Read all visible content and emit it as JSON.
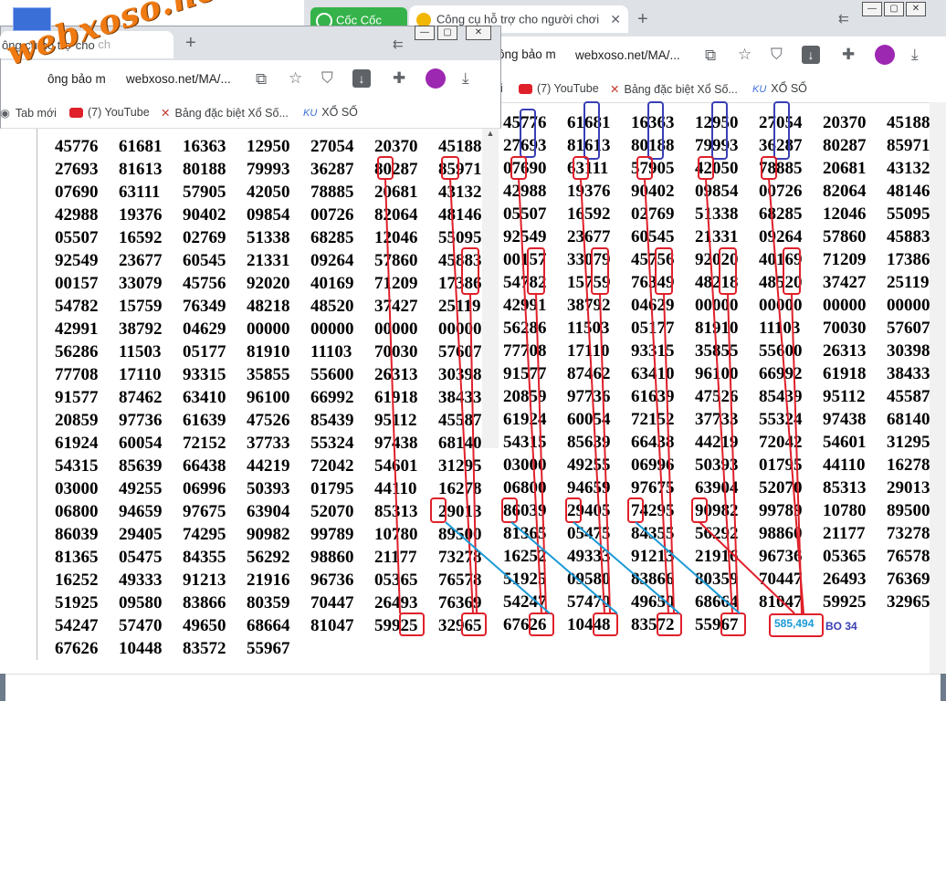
{
  "watermark": "webxoso.net",
  "back_window": {
    "tab_cococ_label": "Cốc Cốc",
    "tab_title": "Công cụ hỗ trợ cho người chơi",
    "tab_close": "✕",
    "new_tab": "+",
    "nav_left_text": "ông bảo m",
    "address": "webxoso.net/MA/...",
    "bookmarks": [
      {
        "icon": "youtube-icon",
        "label": "(7) YouTube"
      },
      {
        "icon": "lottery-site-icon",
        "label": "Bảng đặc biệt Xổ Số..."
      },
      {
        "icon": "xoso-icon",
        "label": "XỔ SỐ"
      }
    ],
    "bookmark_partial": "i"
  },
  "front_window": {
    "tab_title": "ông cụ hỗ trợ cho",
    "tab_title_faded": "ch",
    "new_tab": "+",
    "nav_left_text": "ông bảo m",
    "address": "webxoso.net/MA/...",
    "bookmarks": [
      {
        "icon": "newtab-icon",
        "label": "Tab mới"
      },
      {
        "icon": "youtube-icon",
        "label": "(7) YouTube"
      },
      {
        "icon": "lottery-site-icon",
        "label": "Bảng đặc biệt Xổ Số..."
      },
      {
        "icon": "xoso-icon",
        "label": "XỔ SỐ"
      }
    ]
  },
  "left_grid": [
    [
      "45776",
      "61681",
      "16363",
      "12950",
      "27054",
      "20370",
      "45188"
    ],
    [
      "27693",
      "81613",
      "80188",
      "79993",
      "36287",
      "80287",
      "85971"
    ],
    [
      "07690",
      "63111",
      "57905",
      "42050",
      "78885",
      "20681",
      "43132"
    ],
    [
      "42988",
      "19376",
      "90402",
      "09854",
      "00726",
      "82064",
      "48146"
    ],
    [
      "05507",
      "16592",
      "02769",
      "51338",
      "68285",
      "12046",
      "55095"
    ],
    [
      "92549",
      "23677",
      "60545",
      "21331",
      "09264",
      "57860",
      "45883"
    ],
    [
      "00157",
      "33079",
      "45756",
      "92020",
      "40169",
      "71209",
      "17386"
    ],
    [
      "54782",
      "15759",
      "76349",
      "48218",
      "48520",
      "37427",
      "25119"
    ],
    [
      "42991",
      "38792",
      "04629",
      "00000",
      "00000",
      "00000",
      "00000"
    ],
    [
      "56286",
      "11503",
      "05177",
      "81910",
      "11103",
      "70030",
      "57607"
    ],
    [
      "77708",
      "17110",
      "93315",
      "35855",
      "55600",
      "26313",
      "30398"
    ],
    [
      "91577",
      "87462",
      "63410",
      "96100",
      "66992",
      "61918",
      "38433"
    ],
    [
      "20859",
      "97736",
      "61639",
      "47526",
      "85439",
      "95112",
      "45587"
    ],
    [
      "61924",
      "60054",
      "72152",
      "37733",
      "55324",
      "97438",
      "68140"
    ],
    [
      "54315",
      "85639",
      "66438",
      "44219",
      "72042",
      "54601",
      "31295"
    ],
    [
      "03000",
      "49255",
      "06996",
      "50393",
      "01795",
      "44110",
      "16278"
    ],
    [
      "06800",
      "94659",
      "97675",
      "63904",
      "52070",
      "85313",
      "29013"
    ],
    [
      "86039",
      "29405",
      "74295",
      "90982",
      "99789",
      "10780",
      "89500"
    ],
    [
      "81365",
      "05475",
      "84355",
      "56292",
      "98860",
      "21177",
      "73278"
    ],
    [
      "16252",
      "49333",
      "91213",
      "21916",
      "96736",
      "05365",
      "76578"
    ],
    [
      "51925",
      "09580",
      "83866",
      "80359",
      "70447",
      "26493",
      "76369"
    ],
    [
      "54247",
      "57470",
      "49650",
      "68664",
      "81047",
      "59925",
      "32965"
    ],
    [
      "67626",
      "10448",
      "83572",
      "55967",
      "",
      "",
      ""
    ]
  ],
  "right_grid": [
    [
      "45776",
      "61681",
      "16363",
      "12950",
      "27054",
      "20370",
      "45188"
    ],
    [
      "27693",
      "81613",
      "80188",
      "79993",
      "36287",
      "80287",
      "85971"
    ],
    [
      "07690",
      "63111",
      "57905",
      "42050",
      "78885",
      "20681",
      "43132"
    ],
    [
      "42988",
      "19376",
      "90402",
      "09854",
      "00726",
      "82064",
      "48146"
    ],
    [
      "05507",
      "16592",
      "02769",
      "51338",
      "68285",
      "12046",
      "55095"
    ],
    [
      "92549",
      "23677",
      "60545",
      "21331",
      "09264",
      "57860",
      "45883"
    ],
    [
      "00157",
      "33079",
      "45756",
      "92020",
      "40169",
      "71209",
      "17386"
    ],
    [
      "54782",
      "15759",
      "76349",
      "48218",
      "48520",
      "37427",
      "25119"
    ],
    [
      "42991",
      "38792",
      "04629",
      "00000",
      "00000",
      "00000",
      "00000"
    ],
    [
      "56286",
      "11503",
      "05177",
      "81910",
      "11103",
      "70030",
      "57607"
    ],
    [
      "77708",
      "17110",
      "93315",
      "35855",
      "55600",
      "26313",
      "30398"
    ],
    [
      "91577",
      "87462",
      "63410",
      "96100",
      "66992",
      "61918",
      "38433"
    ],
    [
      "20859",
      "97736",
      "61639",
      "47526",
      "85439",
      "95112",
      "45587"
    ],
    [
      "61924",
      "60054",
      "72152",
      "37733",
      "55324",
      "97438",
      "68140"
    ],
    [
      "54315",
      "85639",
      "66438",
      "44219",
      "72042",
      "54601",
      "31295"
    ],
    [
      "03000",
      "49255",
      "06996",
      "50393",
      "01795",
      "44110",
      "16278"
    ],
    [
      "06800",
      "94659",
      "97675",
      "63904",
      "52070",
      "85313",
      "29013"
    ],
    [
      "86039",
      "29405",
      "74295",
      "90982",
      "99789",
      "10780",
      "89500"
    ],
    [
      "81365",
      "05475",
      "84355",
      "56292",
      "98860",
      "21177",
      "73278"
    ],
    [
      "16252",
      "49333",
      "91213",
      "21916",
      "96736",
      "05365",
      "76578"
    ],
    [
      "51925",
      "09580",
      "83866",
      "80359",
      "70447",
      "26493",
      "76369"
    ],
    [
      "54247",
      "57470",
      "49650",
      "68664",
      "81047",
      "59925",
      "32965"
    ],
    [
      "67626",
      "10448",
      "83572",
      "55967",
      "",
      "",
      ""
    ]
  ],
  "annotation": {
    "result_label": "585,494",
    "bo_label": "BO 34",
    "colors": {
      "red": "#e0202a",
      "blue": "#3a3fb5",
      "cyan": "#1a9ad6",
      "watermark": "#f07a12"
    }
  }
}
